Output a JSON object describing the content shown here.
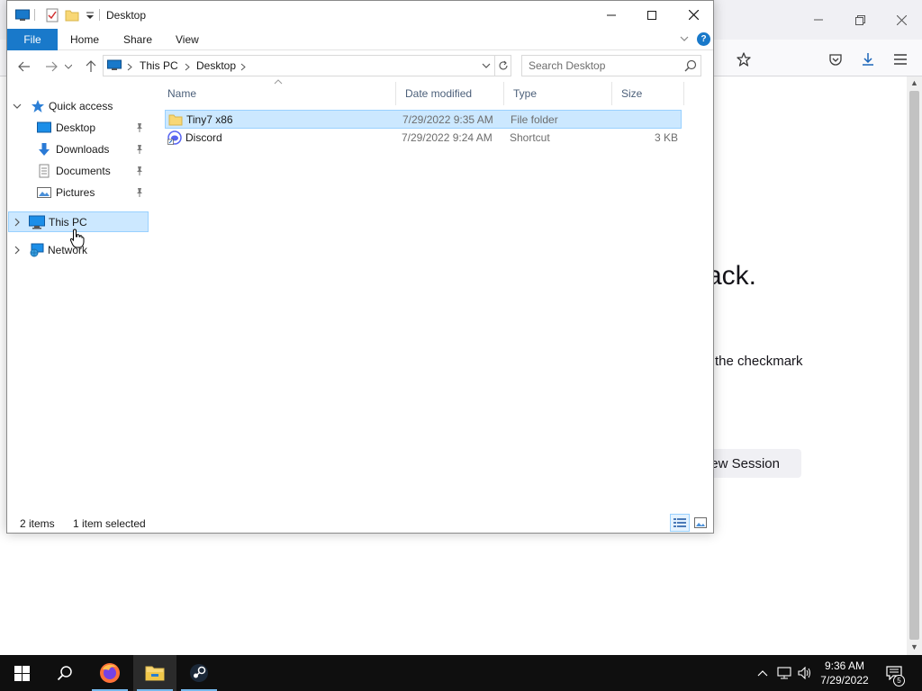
{
  "browser": {
    "heading_fragment": "ack.",
    "text_fragment": "the checkmark",
    "button_fragment": "ew Session"
  },
  "explorer": {
    "title": "Desktop",
    "ribbon_tabs": [
      "File",
      "Home",
      "Share",
      "View"
    ],
    "address": {
      "crumbs": [
        "This PC",
        "Desktop"
      ]
    },
    "search": {
      "placeholder": "Search Desktop"
    },
    "nav": {
      "quick_access": "Quick access",
      "pinned": [
        {
          "label": "Desktop",
          "icon": "desktop-icon"
        },
        {
          "label": "Downloads",
          "icon": "downloads-icon"
        },
        {
          "label": "Documents",
          "icon": "documents-icon"
        },
        {
          "label": "Pictures",
          "icon": "pictures-icon"
        }
      ],
      "this_pc": "This PC",
      "network": "Network"
    },
    "columns": [
      "Name",
      "Date modified",
      "Type",
      "Size"
    ],
    "files": [
      {
        "name": "Tiny7 x86",
        "date": "7/29/2022 9:35 AM",
        "type": "File folder",
        "size": "",
        "icon": "folder-icon",
        "selected": true
      },
      {
        "name": "Discord",
        "date": "7/29/2022 9:24 AM",
        "type": "Shortcut",
        "size": "3 KB",
        "icon": "discord-shortcut-icon",
        "selected": false
      }
    ],
    "status": {
      "count": "2 items",
      "selection": "1 item selected"
    }
  },
  "taskbar": {
    "time": "9:36 AM",
    "date": "7/29/2022",
    "notifications": "5",
    "apps": [
      "firefox-icon",
      "file-explorer-icon",
      "steam-icon"
    ]
  },
  "colors": {
    "accent": "#1979ca",
    "selection": "#cce8ff",
    "selection_border": "#99d1ff",
    "taskbar": "#0f0f0f"
  }
}
